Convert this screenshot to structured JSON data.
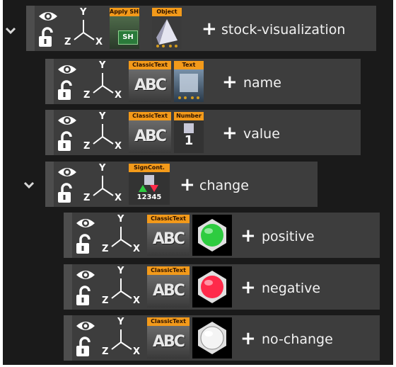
{
  "nodes": [
    {
      "label": "stock-visualization",
      "thumbs": [
        "Apply SHM",
        "Object"
      ],
      "expanded": true
    },
    {
      "label": "name",
      "thumbs": [
        "ClassicText",
        "Text"
      ]
    },
    {
      "label": "value",
      "thumbs": [
        "ClassicText",
        "Number"
      ]
    },
    {
      "label": "change",
      "thumbs": [
        "SignCont."
      ],
      "expanded": true
    },
    {
      "label": "positive",
      "thumbs": [
        "ClassicText"
      ],
      "ball_color": "#2ecc40"
    },
    {
      "label": "negative",
      "thumbs": [
        "ClassicText"
      ],
      "ball_color": "#ff2a4a"
    },
    {
      "label": "no-change",
      "thumbs": [
        "ClassicText"
      ],
      "ball_color": "#ffffff"
    }
  ],
  "axis_labels": {
    "y": "Y",
    "z": "Z",
    "x": "X"
  },
  "thumb_text": {
    "abc": "ABC",
    "signcont_digits": "12345",
    "number_digit": "1",
    "shm": "SH"
  },
  "colors": {
    "tag": "#f39a1a",
    "row": "#3d3d3d",
    "background": "#1a1a1a"
  }
}
